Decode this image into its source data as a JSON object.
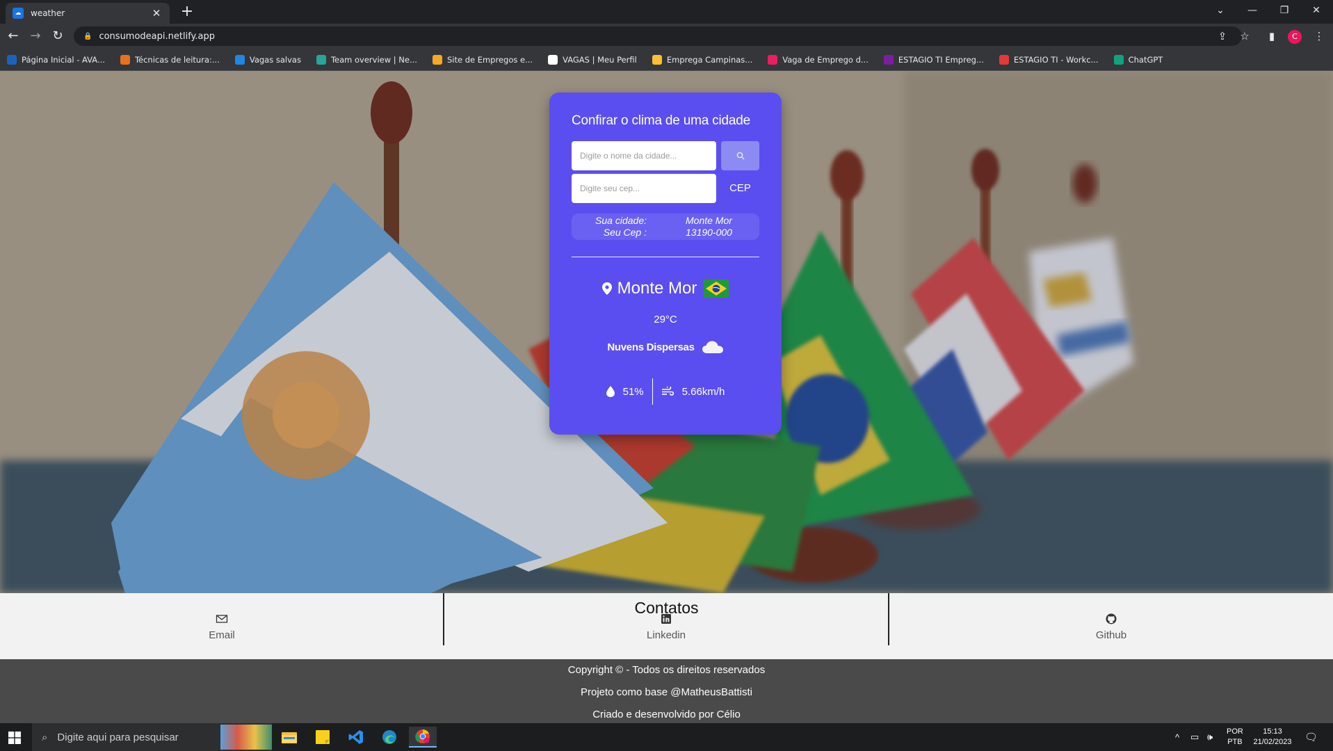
{
  "browser": {
    "tab_title": "weather",
    "new_tab": "+",
    "url": "consumodeapi.netlify.app",
    "profile_initial": "C",
    "bookmarks": [
      {
        "label": "Página Inicial - AVA...",
        "color": "#1565c0"
      },
      {
        "label": "Técnicas de leitura:...",
        "color": "#e8711c"
      },
      {
        "label": "Vagas salvas",
        "color": "#1e88e5"
      },
      {
        "label": "Team overview | Ne...",
        "color": "#26a69a"
      },
      {
        "label": "Site de Empregos e...",
        "color": "#f9a825"
      },
      {
        "label": "VAGAS | Meu Perfil",
        "color": "#ffffff"
      },
      {
        "label": "Emprega Campinas...",
        "color": "#fbc02d"
      },
      {
        "label": "Vaga de Emprego d...",
        "color": "#e91e63"
      },
      {
        "label": "ESTAGIO TI Empreg...",
        "color": "#7b1fa2"
      },
      {
        "label": "ESTAGIO TI - Workc...",
        "color": "#e53935"
      },
      {
        "label": "ChatGPT",
        "color": "#10a37f"
      }
    ]
  },
  "weather_card": {
    "title": "Confirar o clima de uma cidade",
    "city_placeholder": "Digite o nome da cidade...",
    "cep_placeholder": "Digite seu cep...",
    "cep_button": "CEP",
    "info": {
      "city_label": "Sua cidade:",
      "city_value": "Monte Mor",
      "cep_label": "Seu Cep :",
      "cep_value": "13190-000"
    },
    "city": "Monte Mor",
    "temperature": "29°C",
    "description": "Nuvens Dispersas",
    "humidity": "51%",
    "wind": "5.66km/h",
    "icons": [
      "search-icon",
      "location-pin-icon",
      "brazil-flag-icon",
      "cloud-icon",
      "droplet-icon",
      "wind-icon"
    ]
  },
  "contacts": {
    "title": "Contatos",
    "items": [
      {
        "label": "Email",
        "icon": "mail-icon"
      },
      {
        "label": "Linkedin",
        "icon": "linkedin-icon"
      },
      {
        "label": "Github",
        "icon": "github-icon"
      }
    ]
  },
  "footer": {
    "lines": [
      "Copyright © - Todos os direitos reservados",
      "Projeto como base @MatheusBattisti",
      "Criado e desenvolvido por Célio"
    ]
  },
  "taskbar": {
    "search_placeholder": "Digite aqui para pesquisar",
    "lang_top": "POR",
    "lang_bottom": "PTB",
    "time": "15:13",
    "date": "21/02/2023"
  }
}
